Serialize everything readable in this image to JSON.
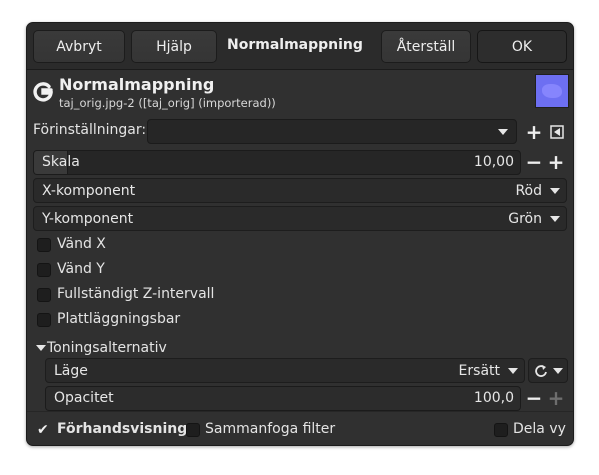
{
  "header": {
    "cancel_label": "Avbryt",
    "help_label": "Hjälp",
    "title": "Normalmappning",
    "reset_label": "Återställ",
    "ok_label": "OK"
  },
  "operation": {
    "title": "Normalmappning",
    "subtitle": "taj_orig.jpg-2 ([taj_orig] (importerad))",
    "thumbnail_color": "#6d6ff2"
  },
  "presets": {
    "label": "Förinställningar:",
    "value": ""
  },
  "scale": {
    "label": "Skala",
    "value": "10,00"
  },
  "x_component": {
    "label": "X-komponent",
    "value": "Röd"
  },
  "y_component": {
    "label": "Y-komponent",
    "value": "Grön"
  },
  "options": {
    "flip_x": "Vänd X",
    "flip_y": "Vänd Y",
    "full_z": "Fullständigt Z-intervall",
    "tileable": "Plattläggningsbar"
  },
  "blending": {
    "section_label": "Toningsalternativ",
    "mode_label": "Läge",
    "mode_value": "Ersätt",
    "opacity_label": "Opacitet",
    "opacity_value": "100,0"
  },
  "footer": {
    "preview_label": "Förhandsvisning",
    "preview_checked": true,
    "merge_label": "Sammanfoga filter",
    "split_label": "Dela vy"
  }
}
